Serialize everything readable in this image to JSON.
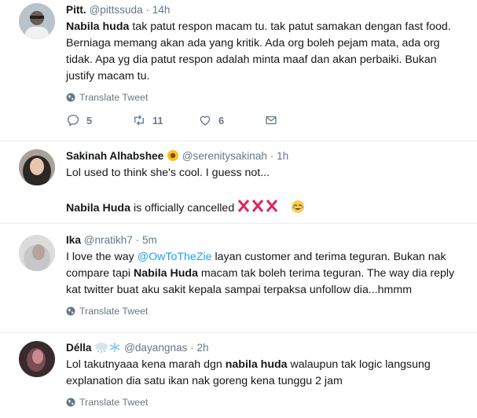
{
  "colors": {
    "link": "#1da1f2",
    "meta": "#657786",
    "text": "#14171a",
    "red_x": "#e0245e"
  },
  "tweets": [
    {
      "name": "Pitt.",
      "handle": "@pittssuda",
      "time": "14h",
      "text_parts": [
        {
          "b": "Nabila huda"
        },
        {
          "t": " tak patut respon macam tu. tak patut samakan dengan fast food. Berniaga memang akan ada yang kritik. Ada org boleh pejam mata, ada org tidak. Apa yg dia patut respon adalah minta maaf dan akan perbaiki. Bukan justify macam tu."
        }
      ],
      "translate_label": "Translate Tweet",
      "replies": "5",
      "retweets": "11",
      "likes": "6"
    },
    {
      "name": "Sakinah Alhabshee",
      "name_emoji": "sunflower-icon",
      "handle": "@serenitysakinah",
      "time": "1h",
      "line1": "Lol used to think she's cool. I guess not...",
      "line2_bold": "Nabila Huda",
      "line2_text": " is officially cancelled"
    },
    {
      "name": "Ika",
      "handle": "@nratikh7",
      "time": "5m",
      "p1": "I love the way ",
      "mention": "@OwToTheZie",
      "p2": " layan customer and terima teguran. Bukan nak compare tapi ",
      "bold": "Nabila Huda",
      "p3": " macam tak boleh terima teguran. The way dia reply kat twitter buat aku sakit kepala sampai terpaksa unfollow dia...hmmm",
      "translate_label": "Translate Tweet"
    },
    {
      "name": "Délla",
      "name_emoji": "cloud-snow-icon",
      "handle": "@dayangnas",
      "time": "2h",
      "p1": "Lol takutnyaaa kena marah dgn ",
      "bold": "nabila huda",
      "p2": " walaupun tak logic langsung explanation dia satu ikan nak goreng kena tunggu 2 jam",
      "translate_label": "Translate Tweet"
    }
  ]
}
